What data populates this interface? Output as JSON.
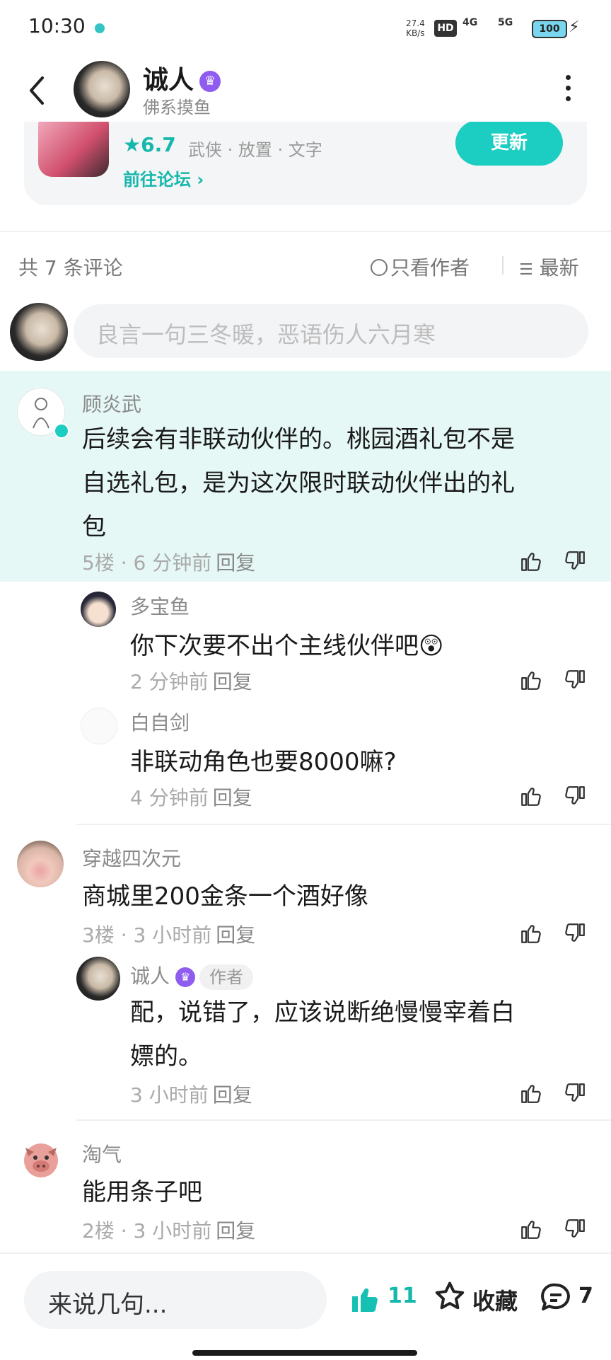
{
  "status_bar": {
    "time": "10:30",
    "net_speed_value": "27.4",
    "net_speed_unit": "KB/s",
    "hd": "HD",
    "sig1": "4G",
    "sig2": "5G",
    "battery": "100"
  },
  "header": {
    "title": "诚人",
    "subtitle": "佛系摸鱼"
  },
  "game_card": {
    "rating": "6.7",
    "tags": "武侠 · 放置 · 文字",
    "forum_link": "前往论坛",
    "update_button": "更新"
  },
  "comments_bar": {
    "count_text": "共 7 条评论",
    "only_author": "只看作者",
    "sort": "最新"
  },
  "compose": {
    "placeholder": "良言一句三冬暖，恶语伤人六月寒"
  },
  "comments": [
    {
      "user": "顾炎武",
      "text": [
        "后续会有非联动伙伴的。桃园酒礼包不是",
        "自选礼包，是为这次限时联动伙伴出的礼",
        "包"
      ],
      "floor": "5楼",
      "time": "6 分钟前",
      "reply": "回复",
      "replies": [
        {
          "user": "多宝鱼",
          "text": "你下次要不出个主线伙伴吧",
          "time": "2 分钟前",
          "reply": "回复"
        },
        {
          "user": "白自剑",
          "text": "非联动角色也要8000嘛?",
          "time": "4 分钟前",
          "reply": "回复"
        }
      ]
    },
    {
      "user": "穿越四次元",
      "text": [
        "商城里200金条一个酒好像"
      ],
      "floor": "3楼",
      "time": "3 小时前",
      "reply": "回复",
      "replies": [
        {
          "user": "诚人",
          "author_tag": "作者",
          "text1": "配，说错了，应该说断绝慢慢宰着白",
          "text2": "嫖的。",
          "time": "3 小时前",
          "reply": "回复"
        }
      ]
    },
    {
      "user": "淘气",
      "text": [
        "能用条子吧"
      ],
      "floor": "2楼",
      "time": "3 小时前",
      "reply": "回复"
    }
  ],
  "bottom_bar": {
    "placeholder": "来说几句...",
    "likes": "11",
    "favorite": "收藏",
    "comments": "7"
  },
  "colors": {
    "accent": "#1ccdc1",
    "highlight_bg": "#e5f8f6",
    "badge": "#8f5cf0"
  }
}
